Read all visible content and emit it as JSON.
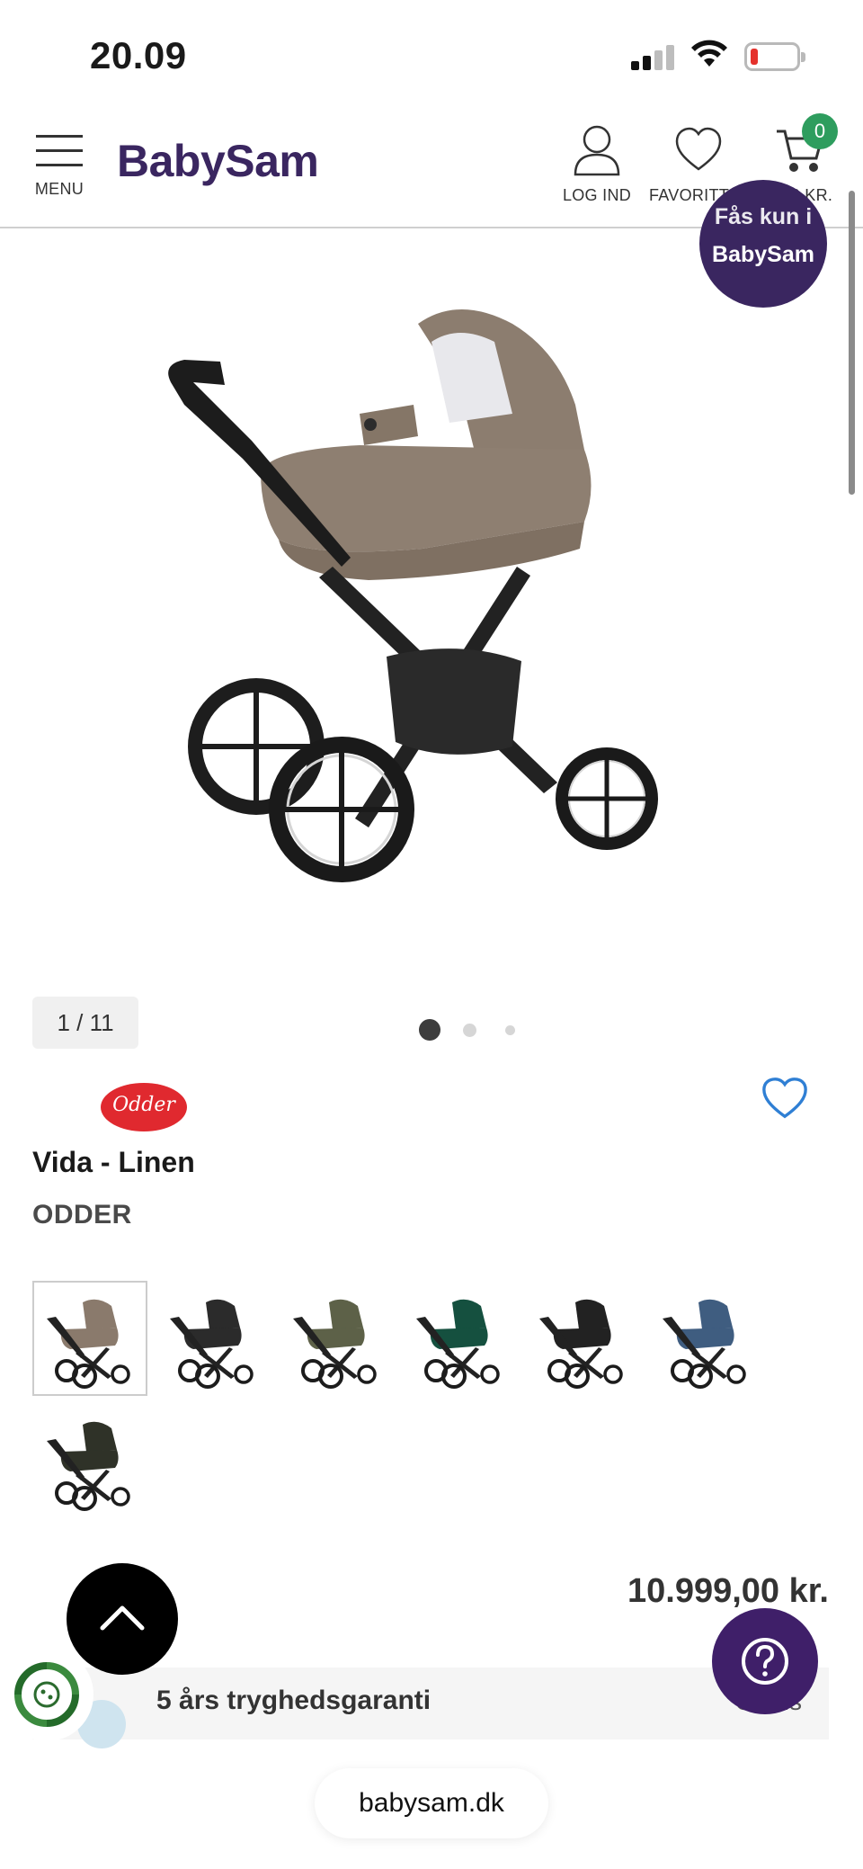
{
  "status_bar": {
    "time": "20.09"
  },
  "header": {
    "menu_label": "MENU",
    "logo_text": "BabySam",
    "login_label": "LOG IND",
    "favorites_label": "FAVORITTER",
    "cart_total": "0,00 KR.",
    "cart_count": "0"
  },
  "gallery": {
    "promo_line1": "Fås kun i",
    "promo_line2": "BabySam",
    "counter": "1 / 11",
    "active_dot": 1
  },
  "product": {
    "brand_logo_text": "Odder",
    "name": "Vida - Linen",
    "brand": "ODDER",
    "price": "10.999,00 kr.",
    "variants": [
      {
        "color": "#8a7a6c"
      },
      {
        "color": "#2b2b2b"
      },
      {
        "color": "#5d6148"
      },
      {
        "color": "#15503f"
      },
      {
        "color": "#222222"
      },
      {
        "color": "#3f5d80"
      },
      {
        "color": "#2f3228"
      }
    ]
  },
  "guarantee": {
    "text": "5 års tryghedsgaranti",
    "price": "Gratis"
  },
  "browser": {
    "url": "babysam.dk"
  },
  "colors": {
    "brand_purple": "#3a2660",
    "help_purple": "#3f1f69",
    "cart_green": "#2e9d5e",
    "heart_blue": "#2f7fd4"
  }
}
